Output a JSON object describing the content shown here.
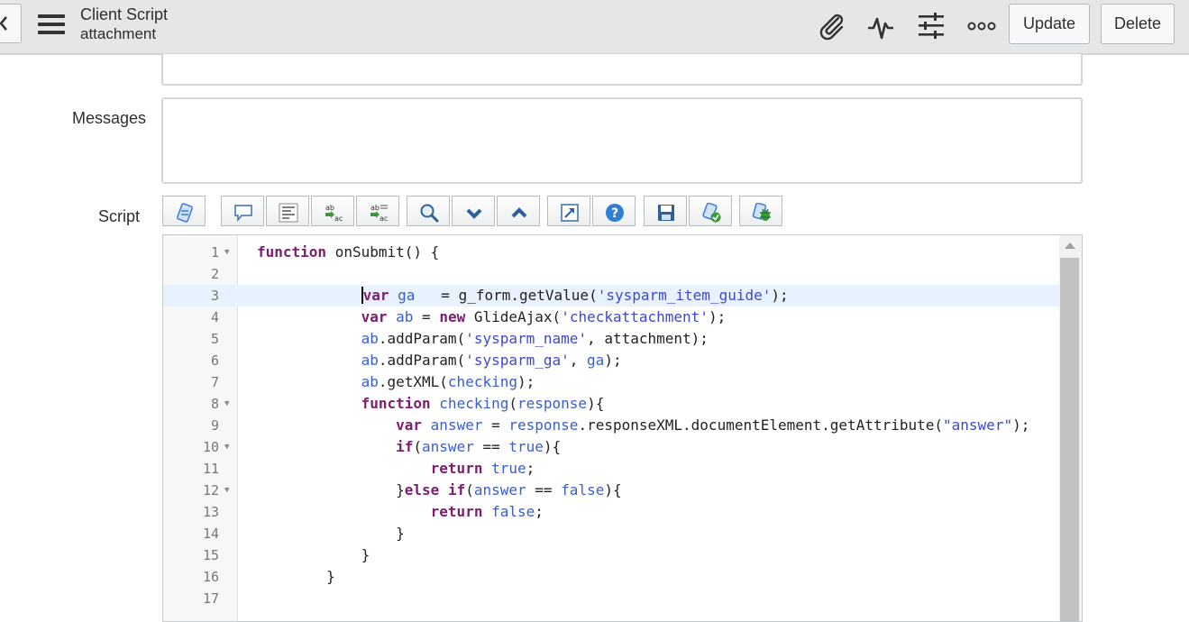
{
  "header": {
    "title": "Client Script",
    "subtitle": "attachment",
    "update_label": "Update",
    "delete_label": "Delete",
    "icons": [
      "back-icon",
      "menu-icon",
      "paperclip-icon",
      "activity-icon",
      "settings-sliders-icon",
      "more-options-icon"
    ]
  },
  "form": {
    "messages_label": "Messages",
    "script_label": "Script"
  },
  "toolbar": {
    "icons": [
      "script-include-icon",
      "comment-icon",
      "format-code-icon",
      "replace-icon",
      "replace-all-icon",
      "search-icon",
      "next-match-icon",
      "previous-match-icon",
      "fullscreen-icon",
      "help-icon",
      "save-icon",
      "syntax-check-icon",
      "debug-icon"
    ]
  },
  "editor": {
    "lines": [
      {
        "n": "1",
        "fold": true,
        "text": "function onSubmit() {"
      },
      {
        "n": "2",
        "fold": false,
        "text": ""
      },
      {
        "n": "3",
        "fold": false,
        "text": "            var ga   = g_form.getValue('sysparm_item_guide');"
      },
      {
        "n": "4",
        "fold": false,
        "text": "            var ab = new GlideAjax('checkattachment');"
      },
      {
        "n": "5",
        "fold": false,
        "text": "            ab.addParam('sysparm_name', attachment);"
      },
      {
        "n": "6",
        "fold": false,
        "text": "            ab.addParam('sysparm_ga', ga);"
      },
      {
        "n": "7",
        "fold": false,
        "text": "            ab.getXML(checking);"
      },
      {
        "n": "8",
        "fold": true,
        "text": "            function checking(response){"
      },
      {
        "n": "9",
        "fold": false,
        "text": "                var answer = response.responseXML.documentElement.getAttribute(\"answer\");"
      },
      {
        "n": "10",
        "fold": true,
        "text": "                if(answer == true){"
      },
      {
        "n": "11",
        "fold": false,
        "text": "                    return true;"
      },
      {
        "n": "12",
        "fold": true,
        "text": "                }else if(answer == false){"
      },
      {
        "n": "13",
        "fold": false,
        "text": "                    return false;"
      },
      {
        "n": "14",
        "fold": false,
        "text": "                }"
      },
      {
        "n": "15",
        "fold": false,
        "text": "            }"
      },
      {
        "n": "16",
        "fold": false,
        "text": "        }"
      },
      {
        "n": "17",
        "fold": false,
        "text": ""
      }
    ],
    "active_line": "3"
  }
}
